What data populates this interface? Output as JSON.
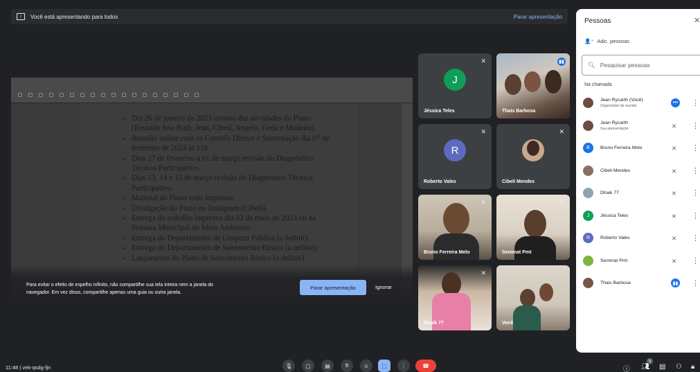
{
  "banner": {
    "text": "Você está apresentando para todos",
    "stop_link": "Parar apresentação"
  },
  "shared_doc": {
    "lines": [
      "Dia 26 de janeiro de 2023 retorno das atividades do Plano (Reunião Ana Ruth, Jean, Cibeli, Angelo, Geda e Madeira).",
      "Reunião online com os Comitês Diretor e Sustentação dia 07 de fevereiro de 2023 às 11h.",
      "Dias 27 de fevereiro a 01 de março revisão do Diagnóstico Técnico Participativo.",
      "Dias 13, 14 e 15 de março revisão do Diagnóstico Técnico Participativo.",
      "Material do Plano todo impresso.",
      "Divulgação do Plano no Instagram (Cibeli).",
      "Entrega do trabalho impresso dia 02 de maio de 2023 ou na Semana Municipal do Meio Ambiente.",
      "Entrega do Departamento de Limpeza Pública (a definir).",
      "Entrega do Departamento de Saneamento Básico (a definir).",
      "Lançamento do Plano de Saneamento Básico (a definir)."
    ]
  },
  "mirror_warning": {
    "text": "Para evitar o efeito de espelho infinito, não compartilhe sua tela inteira nem a janela do navegador. Em vez disso, compartilhe apenas uma guia ou outra janela.",
    "stop_button": "Parar apresentação",
    "ignore_button": "Ignorar"
  },
  "tiles": [
    {
      "name": "Jéssica Teles",
      "initial": "J",
      "color": "#0f9d58"
    },
    {
      "name": "Thais Barbosa"
    },
    {
      "name": "Roberto Vales",
      "initial": "R",
      "color": "#5c6bc0"
    },
    {
      "name": "Cibeli Mendes"
    },
    {
      "name": "Bruno Ferreira Melo"
    },
    {
      "name": "Semmat Pmt"
    },
    {
      "name": "Dhaik 77"
    },
    {
      "name": "Você"
    }
  ],
  "panel": {
    "title": "Pessoas",
    "add_people": "Adic. pessoas",
    "search_placeholder": "Pesquisar pessoas",
    "section": "Na chamada",
    "people": [
      {
        "name": "Jean Rycarth (Você)",
        "sub": "Organizador da reunião",
        "initial": "",
        "color": "#6d4c41"
      },
      {
        "name": "Jean Rycarth",
        "sub": "Sua apresentação",
        "initial": "",
        "color": "#6d4c41"
      },
      {
        "name": "Bruno Ferreira Melo",
        "sub": "",
        "initial": "B",
        "color": "#1a73e8"
      },
      {
        "name": "Cibeli Mendes",
        "sub": "",
        "initial": "",
        "color": "#8d6e63"
      },
      {
        "name": "Dhaik 77",
        "sub": "",
        "initial": "",
        "color": "#90a4ae"
      },
      {
        "name": "Jéssica Teles",
        "sub": "",
        "initial": "J",
        "color": "#0f9d58"
      },
      {
        "name": "Roberto Vales",
        "sub": "",
        "initial": "R",
        "color": "#5c6bc0"
      },
      {
        "name": "Semmat Pmt",
        "sub": "",
        "initial": "",
        "color": "#7cb342"
      },
      {
        "name": "Thais Barbosa",
        "sub": "",
        "initial": "",
        "color": "#795548"
      }
    ]
  },
  "bottom": {
    "meeting_info": "11:48  |  vek-qsdg-fjn",
    "participant_count": "9"
  }
}
